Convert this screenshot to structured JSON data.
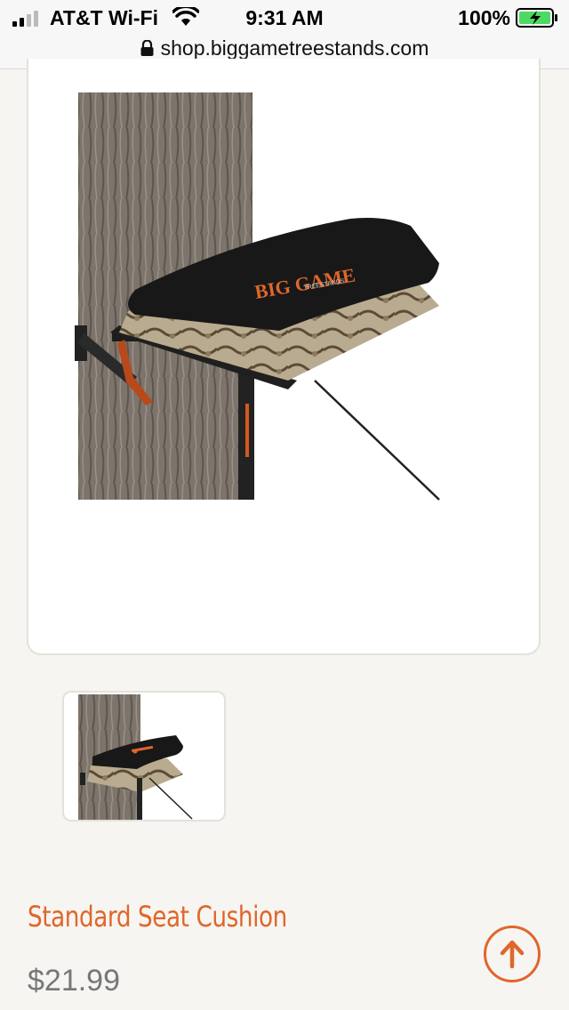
{
  "status_bar": {
    "carrier": "AT&T Wi-Fi",
    "time": "9:31 AM",
    "battery": "100%"
  },
  "browser": {
    "url": "shop.biggametreestands.com"
  },
  "product": {
    "title": "Standard Seat Cushion",
    "price": "$21.99",
    "logo_text": "BIG GAME",
    "logo_subtext": "TREESTANDS"
  },
  "colors": {
    "accent": "#e0662b",
    "price": "#777777",
    "page_background": "#f6f5f1"
  },
  "icons": {
    "lock": "lock-icon",
    "back_to_top": "arrow-up-circle-icon"
  }
}
